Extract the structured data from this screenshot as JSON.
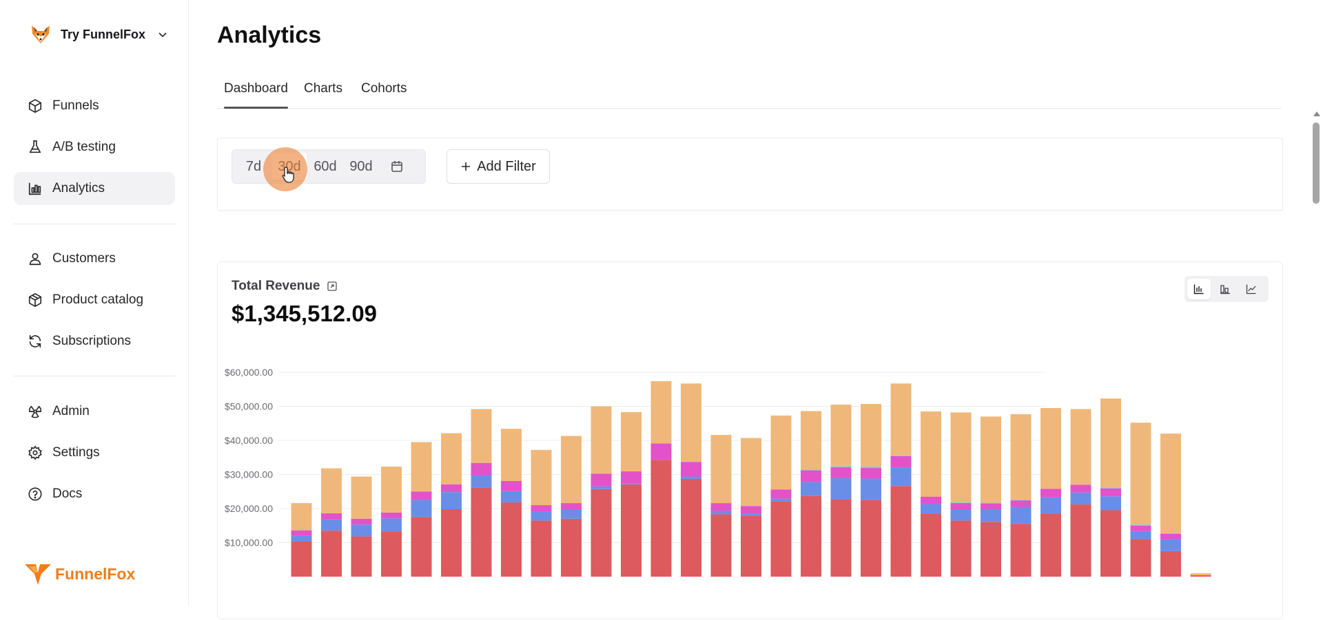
{
  "workspace": {
    "name": "Try FunnelFox",
    "logo_icon": "fox-icon"
  },
  "sidebar": {
    "items": [
      {
        "label": "Funnels",
        "icon": "box-icon"
      },
      {
        "label": "A/B testing",
        "icon": "flask-icon"
      },
      {
        "label": "Analytics",
        "icon": "bar-chart-icon",
        "active": true
      },
      {
        "label": "Customers",
        "icon": "user-icon"
      },
      {
        "label": "Product catalog",
        "icon": "package-icon"
      },
      {
        "label": "Subscriptions",
        "icon": "refresh-icon"
      },
      {
        "label": "Admin",
        "icon": "radiation-icon"
      },
      {
        "label": "Settings",
        "icon": "gear-icon"
      },
      {
        "label": "Docs",
        "icon": "help-circle-icon"
      }
    ],
    "footer_brand": "FunnelFox"
  },
  "page": {
    "title": "Analytics"
  },
  "tabs": [
    {
      "label": "Dashboard",
      "active": true
    },
    {
      "label": "Charts"
    },
    {
      "label": "Cohorts"
    }
  ],
  "filters": {
    "ranges": [
      "7d",
      "30d",
      "60d",
      "90d"
    ],
    "selected_range": "30d",
    "add_filter_label": "Add Filter"
  },
  "revenue": {
    "title": "Total Revenue",
    "total": "$1,345,512.09",
    "views": [
      "stacked-bar-icon",
      "grouped-bar-icon",
      "line-chart-icon"
    ],
    "selected_view": "stacked-bar-icon"
  },
  "colors": {
    "accent": "#ee7d1c",
    "series": [
      "#dd5a5e",
      "#6a8ee8",
      "#e352c8",
      "#7ec8d8",
      "#efb87a"
    ]
  },
  "chart_data": {
    "type": "bar",
    "stacked": true,
    "ylim": [
      0,
      60000
    ],
    "yticks": [
      "$10,000.00",
      "$20,000.00",
      "$30,000.00",
      "$40,000.00",
      "$50,000.00",
      "$60,000.00"
    ],
    "ytick_values": [
      10000,
      20000,
      30000,
      40000,
      50000,
      60000
    ],
    "grid": true,
    "series": [
      {
        "values": [
          10300,
          13500,
          11800,
          13300,
          17500,
          19800,
          26200,
          21800,
          16500,
          17000,
          25700,
          27100,
          34300,
          28700,
          18300,
          17900,
          22100,
          23700,
          22800,
          22500,
          26600,
          18500,
          16500,
          16000,
          15500,
          18500,
          21200,
          19500,
          11000,
          7500,
          400
        ]
      },
      {
        "values": [
          1800,
          3300,
          3500,
          3800,
          5000,
          5000,
          3700,
          3300,
          2500,
          2600,
          800,
          300,
          0,
          700,
          1000,
          600,
          800,
          4100,
          6100,
          6300,
          5500,
          2800,
          3200,
          3600,
          5000,
          4800,
          3500,
          4100,
          2400,
          3600,
          0
        ]
      },
      {
        "values": [
          1500,
          1800,
          1700,
          1700,
          2500,
          2300,
          3500,
          3000,
          2000,
          2000,
          3700,
          3500,
          4800,
          4300,
          2300,
          2200,
          2700,
          3400,
          3200,
          3100,
          3300,
          2200,
          1900,
          1900,
          1900,
          2500,
          2300,
          2300,
          1600,
          1500,
          0
        ]
      },
      {
        "values": [
          0,
          0,
          0,
          0,
          0,
          0,
          0,
          0,
          0,
          0,
          0,
          0,
          0,
          0,
          0,
          0,
          0,
          200,
          300,
          400,
          200,
          0,
          200,
          200,
          200,
          0,
          0,
          300,
          300,
          200,
          0
        ]
      },
      {
        "values": [
          8000,
          13200,
          12400,
          13500,
          14500,
          15000,
          15800,
          15300,
          16200,
          19700,
          19800,
          17400,
          18300,
          23000,
          20000,
          20000,
          21700,
          17200,
          18100,
          18400,
          21100,
          25000,
          26400,
          25300,
          25100,
          23700,
          22200,
          26100,
          29900,
          29200,
          600
        ]
      }
    ]
  }
}
